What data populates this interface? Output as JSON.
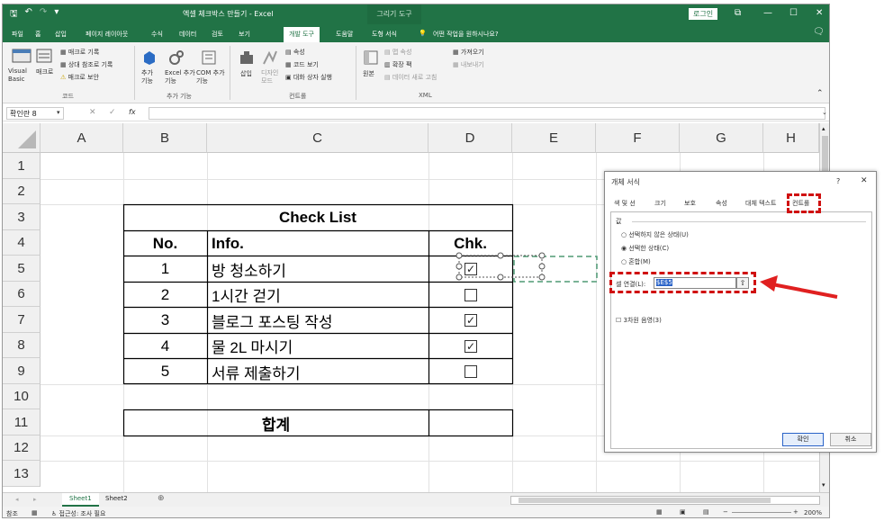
{
  "window": {
    "qa_save": "🖫",
    "qa_undo": "↶",
    "qa_redo": "↷",
    "qa_more": "▾",
    "doc_title": "엑셀 체크박스 만들기  -  Excel",
    "context_tab": "그리기 도구",
    "login": "로그인",
    "restore": "⧉",
    "minimize": "—",
    "maximize": "☐",
    "close": "✕",
    "share": "🗨"
  },
  "tabs": [
    "파일",
    "홈",
    "삽입",
    "페이지 레이아웃",
    "수식",
    "데이터",
    "검토",
    "보기",
    "개발 도구",
    "도움말",
    "도형 서식"
  ],
  "tell_me": "어떤 작업을 원하시나요?",
  "ribbon": {
    "code": {
      "vb": "Visual Basic",
      "macro": "매크로",
      "rec": "매크로 기록",
      "rel": "상대 참조로 기록",
      "sec": "매크로 보안",
      "label": "코드"
    },
    "addins": {
      "add": "추가 기능",
      "excel": "Excel 추가 기능",
      "com": "COM 추가 기능",
      "label": "추가 기능"
    },
    "controls": {
      "insert": "삽입",
      "design": "디자인 모드",
      "props": "속성",
      "view_code": "코드 보기",
      "dialog": "대화 상자 실행",
      "label": "컨트롤"
    },
    "xml": {
      "source": "원본",
      "map": "맵 속성",
      "expand": "확장 팩",
      "refresh": "데이터 새로 고침",
      "import": "가져오기",
      "export": "내보내기",
      "label": "XML"
    }
  },
  "formula_bar": {
    "name_box": "확인란 8",
    "cancel": "✕",
    "enter": "✓",
    "fx": "fx",
    "value": ""
  },
  "columns": [
    "A",
    "B",
    "C",
    "D",
    "E",
    "F",
    "G",
    "H"
  ],
  "rows": [
    "1",
    "2",
    "3",
    "4",
    "5",
    "6",
    "7",
    "8",
    "9",
    "10",
    "11",
    "12",
    "13"
  ],
  "table": {
    "title": "Check List",
    "h_no": "No.",
    "h_info": "Info.",
    "h_chk": "Chk.",
    "items": [
      {
        "no": "1",
        "info": "방 청소하기",
        "checked": true
      },
      {
        "no": "2",
        "info": "1시간 걷기",
        "checked": false
      },
      {
        "no": "3",
        "info": "블로그 포스팅 작성",
        "checked": true
      },
      {
        "no": "4",
        "info": "물 2L 마시기",
        "checked": true
      },
      {
        "no": "5",
        "info": "서류 제출하기",
        "checked": false
      }
    ],
    "total": "합계"
  },
  "sheets": {
    "nav_prev": "◂",
    "nav_next": "▸",
    "tab1": "Sheet1",
    "tab2": "Sheet2",
    "add": "⊕"
  },
  "status": {
    "mode": "참조",
    "access": "접근성: 조사 필요",
    "zoom": "200%"
  },
  "dialog": {
    "title": "개체 서식",
    "help": "?",
    "close": "✕",
    "tabs": [
      "색 및 선",
      "크기",
      "보호",
      "속성",
      "대체 텍스트",
      "컨트롤"
    ],
    "value_label": "값",
    "opt_unchecked": "선택하지 않은 상태(U)",
    "opt_checked": "선택한 상태(C)",
    "opt_mixed": "혼합(M)",
    "link_label": "셀 연결(L):",
    "link_value": "$E$5",
    "shading": "3차원 음영(3)",
    "ok": "확인",
    "cancel": "취소"
  },
  "colors": {
    "excel_green": "#217346",
    "annotation_red": "#d01010"
  }
}
